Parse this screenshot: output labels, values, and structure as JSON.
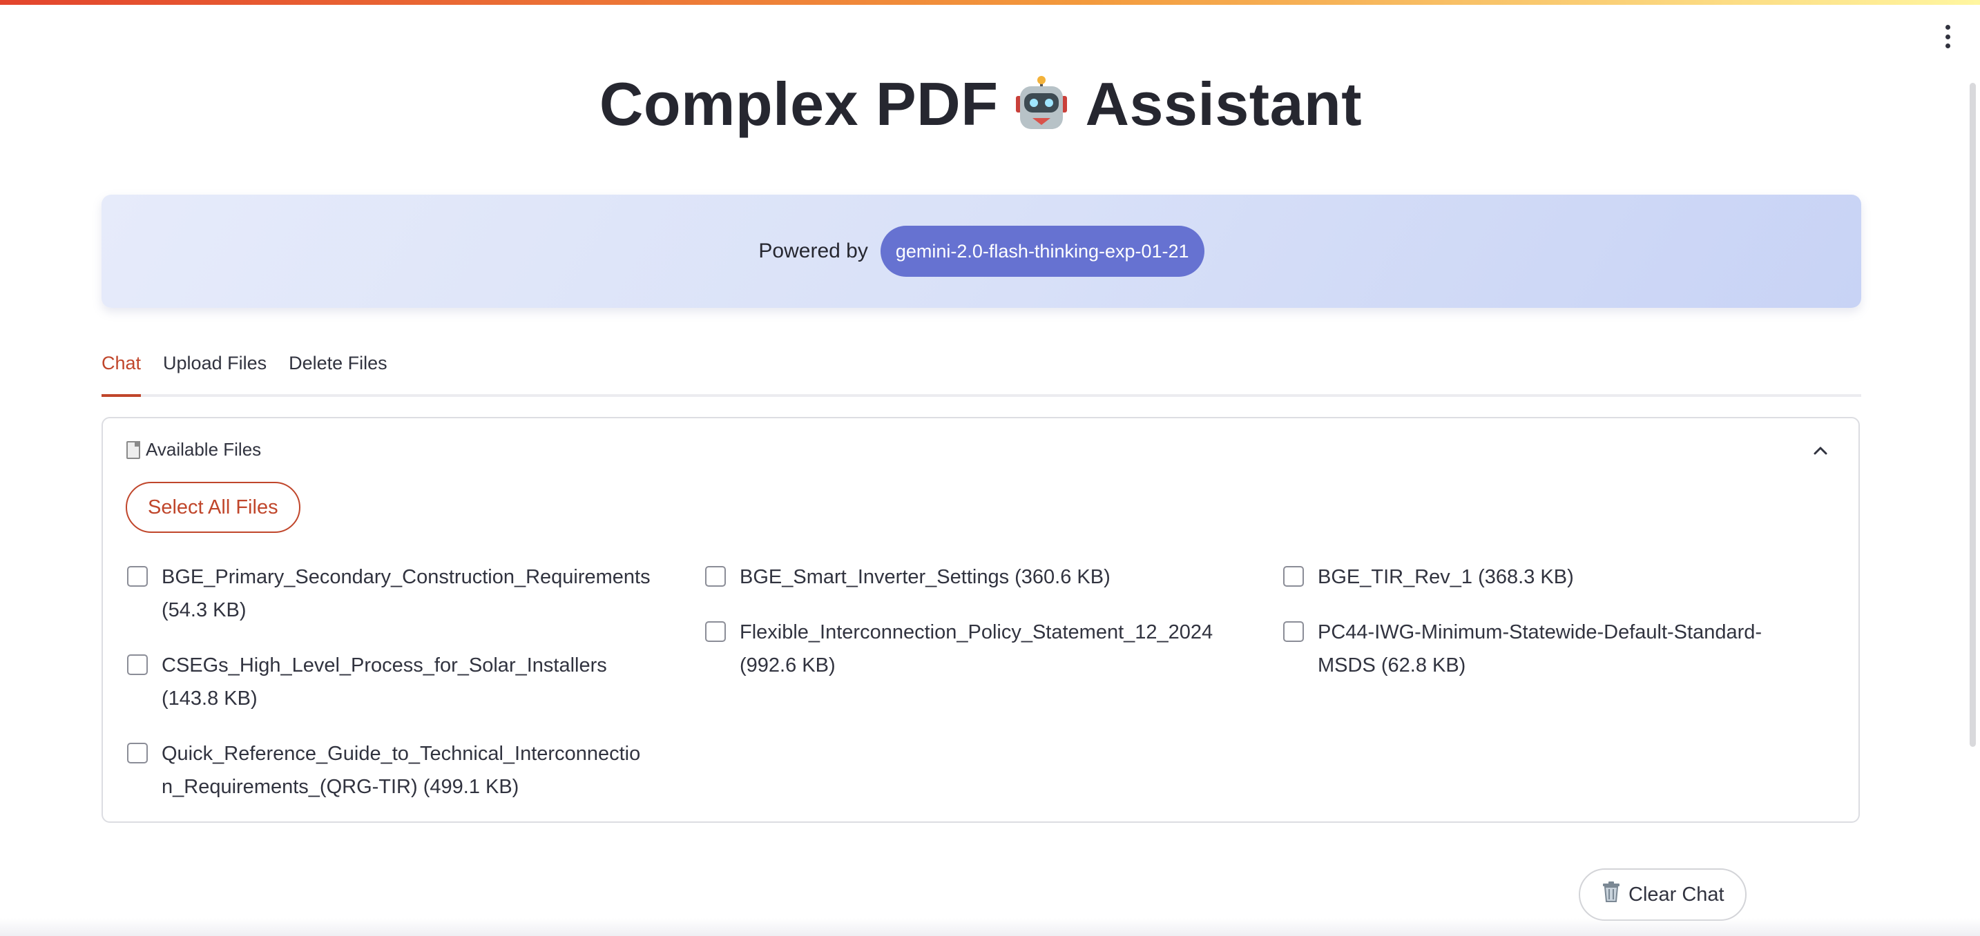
{
  "app": {
    "title_before": "Complex PDF",
    "title_after": "Assistant",
    "title_icon": "robot-icon",
    "accent_color": "#c0462b"
  },
  "banner": {
    "powered_label": "Powered by",
    "model_name": "gemini-2.0-flash-thinking-exp-01-21",
    "pill_color": "#6672d1"
  },
  "tabs": [
    {
      "label": "Chat",
      "active": true
    },
    {
      "label": "Upload Files",
      "active": false
    },
    {
      "label": "Delete Files",
      "active": false
    }
  ],
  "files_panel": {
    "header_label": "Available Files",
    "header_icon": "document-icon",
    "select_all_label": "Select All Files",
    "files": [
      {
        "text": "BGE_Primary_Secondary_Construction_Requirements\n(54.3 KB)",
        "checked": false
      },
      {
        "text": "CSEGs_High_Level_Process_for_Solar_Installers\n(143.8 KB)",
        "checked": false
      },
      {
        "text": "Quick_Reference_Guide_to_Technical_Interconnectio\nn_Requirements_(QRG-TIR) (499.1 KB)",
        "checked": false
      },
      {
        "text": "BGE_Smart_Inverter_Settings (360.6 KB)",
        "checked": false
      },
      {
        "text": "Flexible_Interconnection_Policy_Statement_12_2024\n(992.6 KB)",
        "checked": false
      },
      {
        "text": "BGE_TIR_Rev_1 (368.3 KB)",
        "checked": false
      },
      {
        "text": "PC44-IWG-Minimum-Statewide-Default-Standard-\nMSDS (62.8 KB)",
        "checked": false
      }
    ]
  },
  "footer": {
    "clear_chat_label": "Clear Chat",
    "clear_chat_icon": "trash-icon"
  }
}
